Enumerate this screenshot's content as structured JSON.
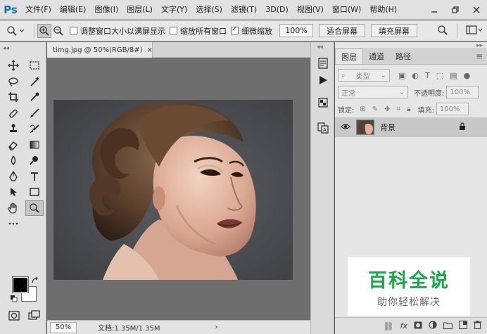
{
  "app": {
    "logo": "Ps",
    "menu": [
      "文件(F)",
      "编辑(E)",
      "图像(I)",
      "图层(L)",
      "文字(Y)",
      "选择(S)",
      "滤镜(T)",
      "3D(D)",
      "视图(V)",
      "窗口(W)",
      "帮助(H)"
    ],
    "window_controls": [
      "minimize-icon",
      "restore-icon",
      "close-icon"
    ]
  },
  "options": {
    "resize_windows": "调整窗口大小以满屏显示",
    "resize_windows_checked": false,
    "zoom_all": "缩放所有窗口",
    "zoom_all_checked": false,
    "scrubby_zoom": "细微缩放",
    "scrubby_zoom_checked": true,
    "zoom_value": "100%",
    "fit_screen": "适合屏幕",
    "fill_screen": "填充屏幕"
  },
  "document": {
    "tab_title": "timg.jpg @ 50%(RGB/8#)",
    "status_zoom": "50%",
    "status_doc": "文档:1.35M/1.35M"
  },
  "layers_panel": {
    "tabs": [
      "图层",
      "通道",
      "路径"
    ],
    "active_tab": "图层",
    "filter_kind": "类型",
    "blend_mode": "正常",
    "opacity_label": "不透明度:",
    "opacity_value": "100%",
    "lock_label": "锁定:",
    "fill_label": "填充:",
    "fill_value": "100%",
    "layers": [
      {
        "name": "背景",
        "visible": true,
        "locked": true
      }
    ]
  },
  "watermark": {
    "title": "百科全说",
    "subtitle": "助你轻松解决"
  },
  "colors": {
    "ps_blue": "#1b6fb8",
    "watermark_green": "#19a84b",
    "foreground": "#000000",
    "background": "#ffffff"
  }
}
